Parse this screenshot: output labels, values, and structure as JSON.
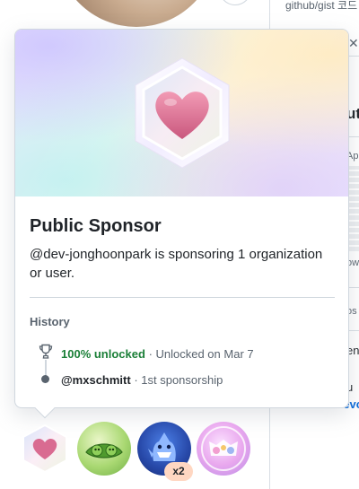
{
  "background": {
    "repo_text": "github/gist 코드",
    "side_texts": [
      "ut",
      "Ap",
      "ow",
      "os",
      "en",
      "u"
    ],
    "side_link": "-devcon",
    "close_glyph": "✕"
  },
  "popover": {
    "title": "Public Sponsor",
    "description": "@dev-jonghoonpark is sponsoring 1 organization or user.",
    "history_heading": "History",
    "unlock_status": "100% unlocked",
    "unlock_date": "· Unlocked on Mar 7",
    "sponsor_user": "@mxschmitt",
    "sponsor_note": "· 1st sponsorship"
  },
  "achievements": [
    {
      "name": "public-sponsor"
    },
    {
      "name": "pair-extraordinaire"
    },
    {
      "name": "quickdraw",
      "multiplier": "x2"
    },
    {
      "name": "yolo"
    }
  ],
  "icons": {
    "hero": "heart-hexagon-icon",
    "trophy": "trophy-icon"
  },
  "colors": {
    "accent_green": "#1a7f37",
    "link_blue": "#0969da",
    "border": "#d0d7de",
    "heart": "#e0789a"
  }
}
